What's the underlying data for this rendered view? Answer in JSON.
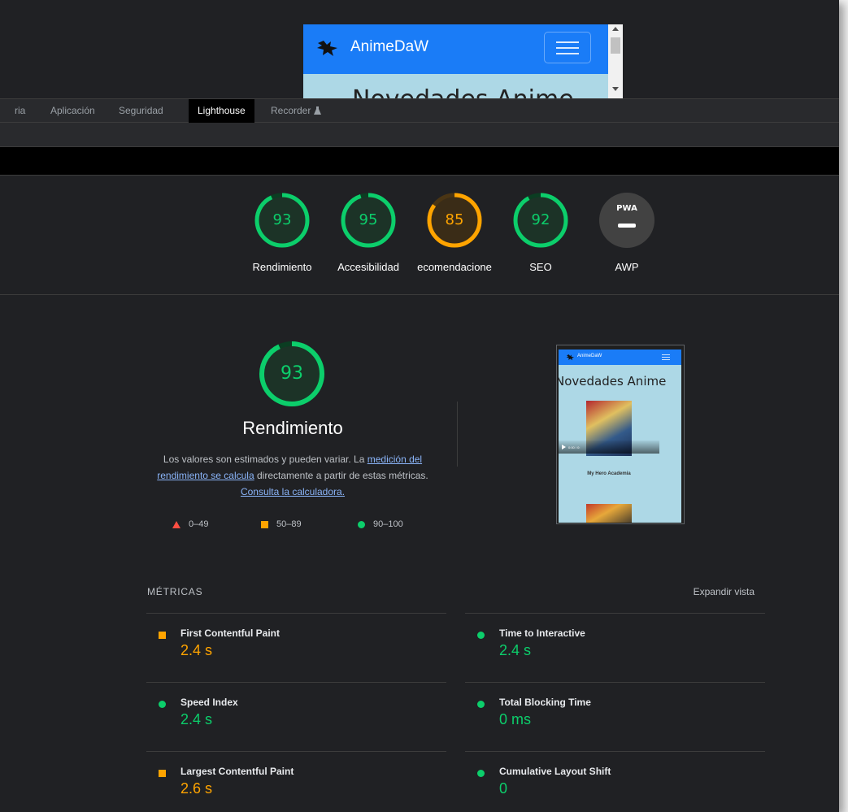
{
  "app_preview": {
    "brand": "AnimeDaW",
    "heading": "Novedades Anime"
  },
  "devtools_tabs": [
    "ria",
    "Aplicación",
    "Seguridad",
    "Lighthouse",
    "Recorder"
  ],
  "active_tab": "Lighthouse",
  "categories": [
    {
      "score": "93",
      "label": "Rendimiento",
      "status": "pass",
      "fraction": 0.93
    },
    {
      "score": "95",
      "label": "Accesibilidad",
      "status": "pass",
      "fraction": 0.95
    },
    {
      "score": "85",
      "label": "ecomendacione",
      "status": "average",
      "fraction": 0.85
    },
    {
      "score": "92",
      "label": "SEO",
      "status": "pass",
      "fraction": 0.92
    },
    {
      "score": "PWA",
      "label": "AWP",
      "status": "na"
    }
  ],
  "performance": {
    "score": "93",
    "fraction": 0.93,
    "title": "Rendimiento",
    "desc_part1": "Los valores son estimados y pueden variar. La ",
    "desc_link1": "medición del rendimiento se calcula",
    "desc_part2": " directamente a partir de estas métricas. ",
    "desc_link2": "Consulta la calculadora.",
    "legend": {
      "fail": "0–49",
      "average": "50–89",
      "pass": "90–100"
    }
  },
  "screenshot_thumb": {
    "brand": "AnimeDaW",
    "title": "Novedades Anime",
    "video_time": "0:00 / 0:",
    "caption": "My Hero Academia"
  },
  "metrics": {
    "title": "MÉTRICAS",
    "expand": "Expandir vista",
    "items": [
      {
        "name": "First Contentful Paint",
        "value": "2.4 s",
        "status": "average"
      },
      {
        "name": "Time to Interactive",
        "value": "2.4 s",
        "status": "pass"
      },
      {
        "name": "Speed Index",
        "value": "2.4 s",
        "status": "pass"
      },
      {
        "name": "Total Blocking Time",
        "value": "0 ms",
        "status": "pass"
      },
      {
        "name": "Largest Contentful Paint",
        "value": "2.6 s",
        "status": "average"
      },
      {
        "name": "Cumulative Layout Shift",
        "value": "0",
        "status": "pass"
      }
    ]
  },
  "colors": {
    "pass": "#0cce6b",
    "average": "#ffa400",
    "fail": "#ff4e42",
    "background": "#202124",
    "link": "#8ab4f8"
  }
}
